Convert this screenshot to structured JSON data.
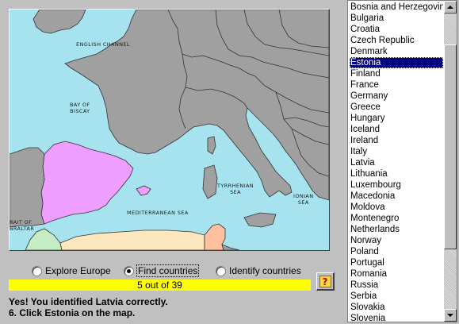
{
  "map": {
    "labels": {
      "english_channel": "English Channel",
      "bay_of_biscay": "Bay of\nBiscay",
      "tyrrhenian_sea": "Tyrrhenian\nSea",
      "ionian_sea": "Ionian\nSea",
      "mediterranean_sea": "Mediterranean Sea",
      "strait_of_gibraltar": "rait of\nbraltar"
    },
    "colors": {
      "sea": "#a6e3ee",
      "land": "#a0a0a0",
      "spain": "#ee9eff",
      "portugal": "#a0a0a0",
      "morocco": "#c6ecc6",
      "algeria": "#fde7bd",
      "tunisia": "#ffc0a0"
    }
  },
  "modes": [
    {
      "label": "Explore Europe",
      "checked": false
    },
    {
      "label": "Find countries",
      "checked": true
    },
    {
      "label": "Identify countries",
      "checked": false
    }
  ],
  "progress": {
    "text": "5 out of 39",
    "color": "#ffff00"
  },
  "help": {
    "glyph": "?",
    "icon": "help-icon"
  },
  "status": {
    "line1": "Yes! You identified Latvia correctly.",
    "line2": "6. Click Estonia on the map."
  },
  "countries": [
    "Bosnia and Herzegovina",
    "Bulgaria",
    "Croatia",
    "Czech Republic",
    "Denmark",
    "Estonia",
    "Finland",
    "France",
    "Germany",
    "Greece",
    "Hungary",
    "Iceland",
    "Ireland",
    "Italy",
    "Latvia",
    "Lithuania",
    "Luxembourg",
    "Macedonia",
    "Moldova",
    "Montenegro",
    "Netherlands",
    "Norway",
    "Poland",
    "Portugal",
    "Romania",
    "Russia",
    "Serbia",
    "Slovakia",
    "Slovenia"
  ],
  "selected_country": "Estonia"
}
